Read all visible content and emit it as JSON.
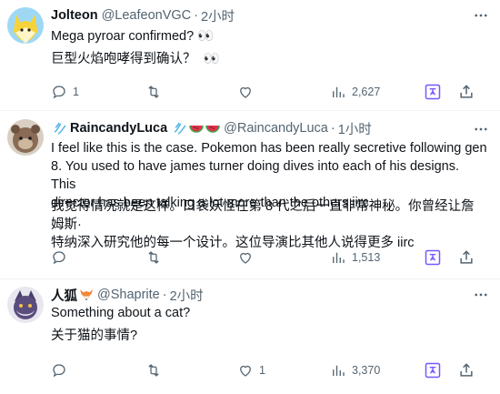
{
  "posts": [
    {
      "name": "Jolteon",
      "handle": "@LeafeonVGC",
      "dot": "·",
      "time": "2小时",
      "lines": [
        "Mega pyroar confirmed? 👀",
        "巨型火焰咆哮得到确认？  👀"
      ],
      "actions": {
        "replies": "1",
        "retweets": "",
        "likes": "",
        "views": "2,627"
      }
    },
    {
      "name": "RaincandyLuca",
      "handle": "@RaincandyLuca",
      "dot": "·",
      "time": "1小时",
      "lines": [
        "I feel like this is the case. Pokemon has been really secretive following gen\n8. You used to have james turner doing dives into each of his designs. This\ndirector has been talking a lot more than the others iirc",
        "我觉得情况就是这样。口袋妖怪在第 8 代之后一直非常神秘。你曾经让詹姆斯·\n特纳深入研究他的每一个设计。这位导演比其他人说得更多 iirc"
      ],
      "actions": {
        "replies": "",
        "retweets": "",
        "likes": "",
        "views": "1,513"
      }
    },
    {
      "name": "人狐",
      "handle": "@Shaprite",
      "dot": "·",
      "time": "2小时",
      "lines": [
        "Something about a cat?",
        "关于猫的事情?"
      ],
      "actions": {
        "replies": "",
        "retweets": "",
        "likes": "1",
        "views": "3,370"
      }
    }
  ],
  "colors": {
    "text": "#0f1419",
    "secondary": "#536471",
    "divider": "#eff3f4",
    "translate_accent": "#7856ff",
    "link_blue": "#1d9bf0"
  },
  "icons": [
    "more-icon",
    "reply-icon",
    "retweet-icon",
    "like-icon",
    "views-icon",
    "translate-icon",
    "share-icon",
    "water-emoji-icon",
    "watermelon-emoji-icon",
    "fox-emoji-icon"
  ]
}
